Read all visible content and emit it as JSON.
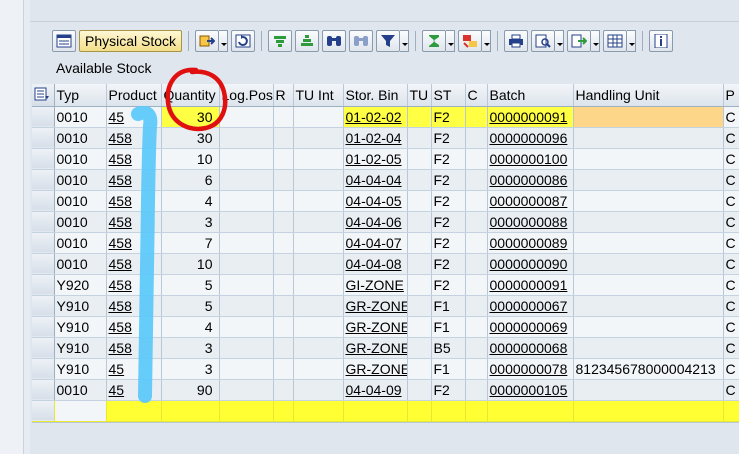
{
  "toolbar": {
    "physical_stock_label": "Physical Stock",
    "icons": [
      "layout-icon",
      "physical-stock",
      "export-icon",
      "refresh-icon",
      "sort-asc-icon",
      "sort-desc-icon",
      "find-icon",
      "find-next-icon",
      "filter-icon",
      "sum-icon",
      "subtotal-icon",
      "print-icon",
      "print-preview-icon",
      "export-file-icon",
      "change-layout-icon",
      "info-icon"
    ]
  },
  "section_title": "Available Stock",
  "columns": [
    "Typ",
    "Product",
    "Quantity",
    "Log.Pos",
    "R",
    "TU Int",
    "Stor. Bin",
    "TU",
    "ST",
    "C",
    "Batch",
    "Handling Unit",
    "P"
  ],
  "rows": [
    {
      "typ": "0010",
      "product": "45",
      "quantity": "30",
      "bin": "01-02-02",
      "st": "F2",
      "batch": "0000000091",
      "hu": "",
      "p": "C"
    },
    {
      "typ": "0010",
      "product": "458",
      "quantity": "30",
      "bin": "01-02-04",
      "st": "F2",
      "batch": "0000000096",
      "hu": "",
      "p": "C"
    },
    {
      "typ": "0010",
      "product": "458",
      "quantity": "10",
      "bin": "01-02-05",
      "st": "F2",
      "batch": "0000000100",
      "hu": "",
      "p": "C"
    },
    {
      "typ": "0010",
      "product": "458",
      "quantity": "6",
      "bin": "04-04-04",
      "st": "F2",
      "batch": "0000000086",
      "hu": "",
      "p": "C"
    },
    {
      "typ": "0010",
      "product": "458",
      "quantity": "4",
      "bin": "04-04-05",
      "st": "F2",
      "batch": "0000000087",
      "hu": "",
      "p": "C"
    },
    {
      "typ": "0010",
      "product": "458",
      "quantity": "3",
      "bin": "04-04-06",
      "st": "F2",
      "batch": "0000000088",
      "hu": "",
      "p": "C"
    },
    {
      "typ": "0010",
      "product": "458",
      "quantity": "7",
      "bin": "04-04-07",
      "st": "F2",
      "batch": "0000000089",
      "hu": "",
      "p": "C"
    },
    {
      "typ": "0010",
      "product": "458",
      "quantity": "10",
      "bin": "04-04-08",
      "st": "F2",
      "batch": "0000000090",
      "hu": "",
      "p": "C"
    },
    {
      "typ": "Y920",
      "product": "458",
      "quantity": "5",
      "bin": "GI-ZONE",
      "st": "F2",
      "batch": "0000000091",
      "hu": "",
      "p": "C"
    },
    {
      "typ": "Y910",
      "product": "458",
      "quantity": "5",
      "bin": "GR-ZONE",
      "st": "F1",
      "batch": "0000000067",
      "hu": "",
      "p": "C"
    },
    {
      "typ": "Y910",
      "product": "458",
      "quantity": "4",
      "bin": "GR-ZONE",
      "st": "F1",
      "batch": "0000000069",
      "hu": "",
      "p": "C"
    },
    {
      "typ": "Y910",
      "product": "458",
      "quantity": "3",
      "bin": "GR-ZONE",
      "st": "B5",
      "batch": "0000000068",
      "hu": "",
      "p": "C"
    },
    {
      "typ": "Y910",
      "product": "45",
      "quantity": "3",
      "bin": "GR-ZONE",
      "st": "F1",
      "batch": "0000000078",
      "hu": "812345678000004213",
      "p": "C"
    },
    {
      "typ": "0010",
      "product": "45",
      "quantity": "90",
      "bin": "04-04-09",
      "st": "F2",
      "batch": "0000000105",
      "hu": "",
      "p": "C"
    }
  ],
  "colors": {
    "highlight_yellow": "#ffff44",
    "selected_orange": "#fdd68a",
    "annotation_red": "#e01010",
    "annotation_blue": "#5ac8fa"
  }
}
